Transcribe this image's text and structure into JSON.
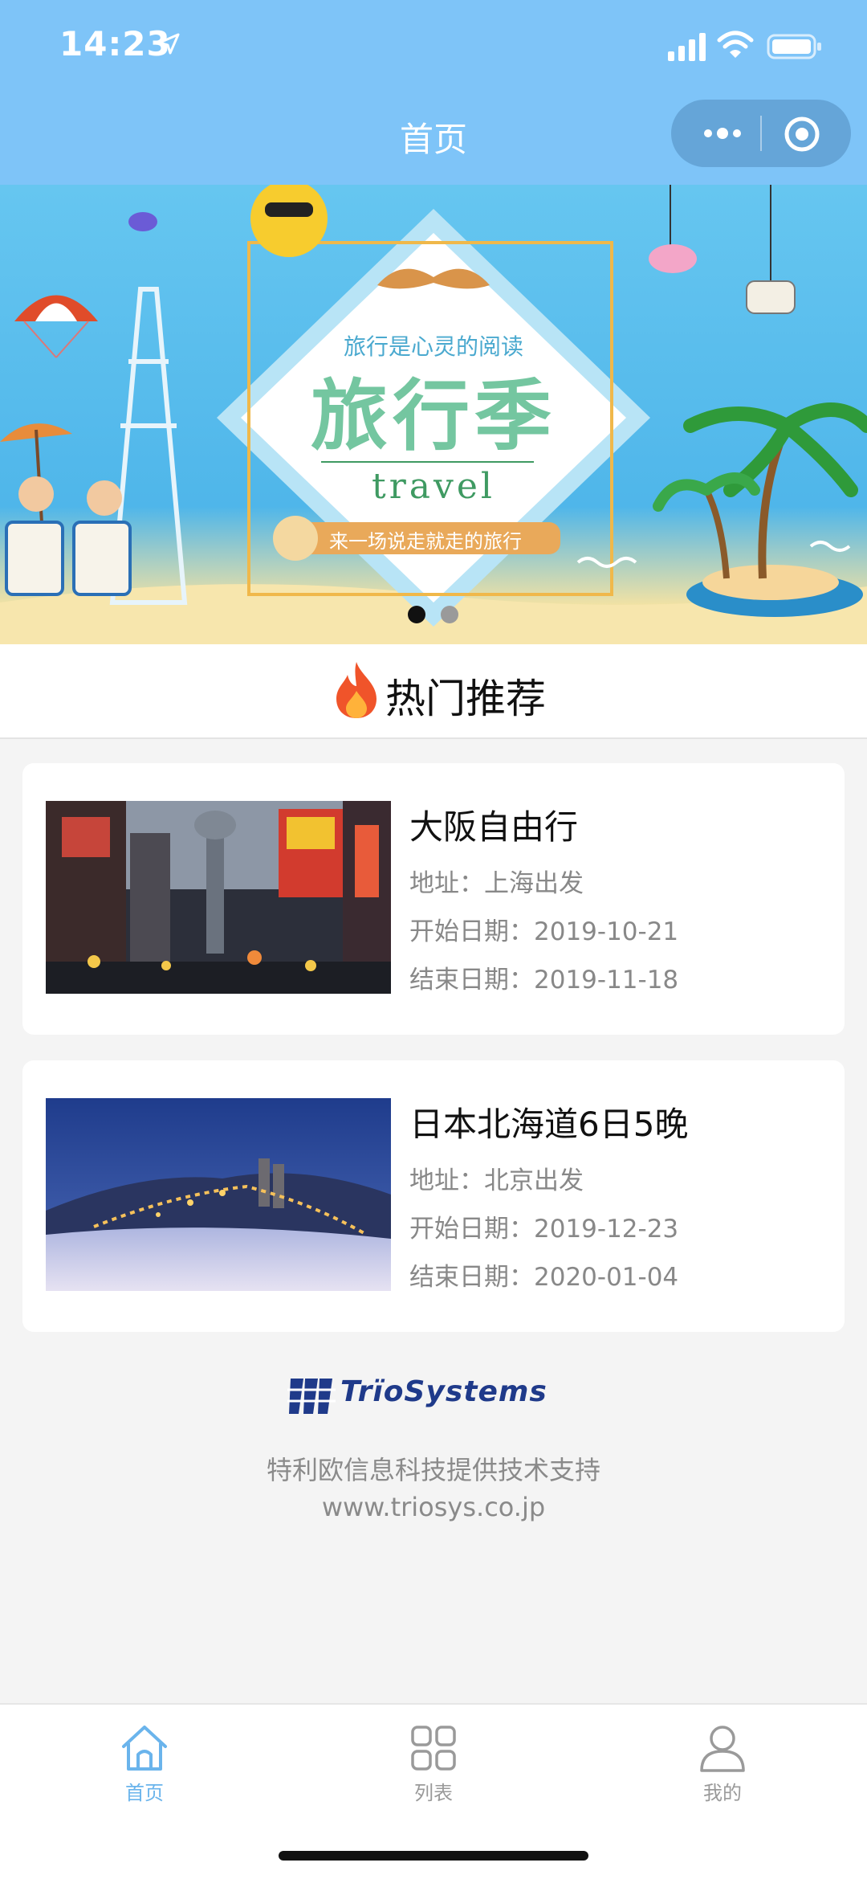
{
  "status_bar": {
    "time": "14:23"
  },
  "nav": {
    "title": "首页"
  },
  "banner": {
    "subtitle": "旅行是心灵的阅读",
    "title": "旅行季",
    "english": "travel",
    "ribbon": "来一场说走就走的旅行",
    "dots": 2,
    "active_dot": 1
  },
  "section": {
    "title": "热门推荐"
  },
  "trips": [
    {
      "title": "大阪自由行",
      "address": "地址：上海出发",
      "start": "开始日期：2019-10-21",
      "end": "结束日期：2019-11-18"
    },
    {
      "title": "日本北海道6日5晚",
      "address": "地址：北京出发",
      "start": "开始日期：2019-12-23",
      "end": "结束日期：2020-01-04"
    }
  ],
  "footer": {
    "brand": "TrïoSystems",
    "support": "特利欧信息科技提供技术支持",
    "website": "www.triosys.co.jp"
  },
  "tabbar": {
    "items": [
      {
        "label": "首页",
        "icon": "home-icon",
        "active": true
      },
      {
        "label": "列表",
        "icon": "grid-icon",
        "active": false
      },
      {
        "label": "我的",
        "icon": "user-icon",
        "active": false
      }
    ],
    "active_color": "#6ab4ec",
    "inactive_color": "#9a9a9a"
  },
  "colors": {
    "nav_bg": "#7ec4f8",
    "page_bg": "#f4f4f4"
  }
}
